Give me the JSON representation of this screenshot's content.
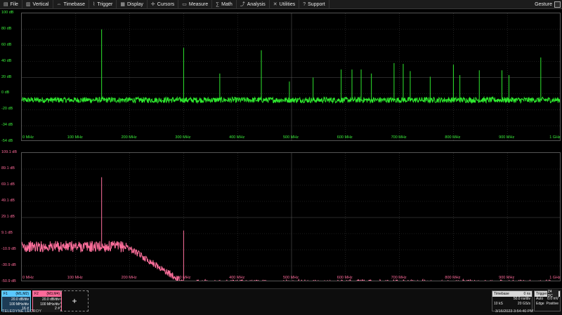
{
  "menu": [
    {
      "label": "File",
      "icon": "file-icon"
    },
    {
      "label": "Vertical",
      "icon": "vertical-icon"
    },
    {
      "label": "Timebase",
      "icon": "timebase-icon"
    },
    {
      "label": "Trigger",
      "icon": "trigger-icon"
    },
    {
      "label": "Display",
      "icon": "display-icon"
    },
    {
      "label": "Cursors",
      "icon": "cursors-icon"
    },
    {
      "label": "Measure",
      "icon": "measure-icon"
    },
    {
      "label": "Math",
      "icon": "math-icon"
    },
    {
      "label": "Analysis",
      "icon": "analysis-icon"
    },
    {
      "label": "Utilities",
      "icon": "utilities-icon"
    },
    {
      "label": "Support",
      "icon": "support-icon"
    }
  ],
  "gesture_label": "Gesture",
  "colors": {
    "trace1": "#2ee82e",
    "trace2": "#ff6f9c",
    "grid": "#3a3a3a"
  },
  "chart_data": [
    {
      "type": "line",
      "title": "",
      "xlabel": "",
      "ylabel": "",
      "x_ticks": [
        "0 MHz",
        "100 MHz",
        "200 MHz",
        "300 MHz",
        "400 MHz",
        "500 MHz",
        "600 MHz",
        "700 MHz",
        "800 MHz",
        "900 MHz",
        "1 GHz"
      ],
      "y_ticks": [
        "100 dB",
        "80 dB",
        "60 dB",
        "40 dB",
        "20 dB",
        "0 dB",
        "-20 dB",
        "-34 dB",
        "-54 dB"
      ],
      "xlim": [
        0,
        1000
      ],
      "ylim": [
        -60,
        100
      ],
      "noise_floor_db": -8,
      "peaks": [
        {
          "x": 148,
          "y": 80
        },
        {
          "x": 300,
          "y": 57
        },
        {
          "x": 367,
          "y": 25
        },
        {
          "x": 444,
          "y": 54
        },
        {
          "x": 496,
          "y": 15
        },
        {
          "x": 540,
          "y": 20
        },
        {
          "x": 592,
          "y": 30
        },
        {
          "x": 612,
          "y": 30
        },
        {
          "x": 629,
          "y": 30
        },
        {
          "x": 648,
          "y": 25
        },
        {
          "x": 690,
          "y": 38
        },
        {
          "x": 707,
          "y": 37
        },
        {
          "x": 720,
          "y": 28
        },
        {
          "x": 757,
          "y": 21
        },
        {
          "x": 800,
          "y": 36
        },
        {
          "x": 812,
          "y": 23
        },
        {
          "x": 848,
          "y": 29
        },
        {
          "x": 890,
          "y": 29
        },
        {
          "x": 903,
          "y": 23
        },
        {
          "x": 962,
          "y": 45
        }
      ]
    },
    {
      "type": "line",
      "title": "",
      "xlabel": "",
      "ylabel": "",
      "x_ticks": [
        "0 MHz",
        "100 MHz",
        "200 MHz",
        "300 MHz",
        "400 MHz",
        "500 MHz",
        "600 MHz",
        "700 MHz",
        "800 MHz",
        "900 MHz",
        "1 GHz"
      ],
      "y_ticks": [
        "109.1 dB",
        "89.1 dB",
        "69.1 dB",
        "49.1 dB",
        "29.1 dB",
        "9.1 dB",
        "-10.9 dB",
        "-30.9 dB",
        "-50.9 dB"
      ],
      "xlim": [
        0,
        1000
      ],
      "ylim": [
        -50.9,
        109.1
      ],
      "passband_level_db": -7,
      "rolloff_start_mhz": 195,
      "rolloff_end_mhz": 300,
      "stopband_level_db": -52,
      "peaks": [
        {
          "x": 148,
          "y": 79
        },
        {
          "x": 300,
          "y": 13
        }
      ]
    }
  ],
  "traces": [
    {
      "name": "F1",
      "source": "(M1,M2)",
      "vdiv": "20.0 dB/div",
      "hdiv": "100 MHz/div",
      "extra": "16 #"
    },
    {
      "name": "F2",
      "source": "(M3,M4)",
      "vdiv": "20.0 dB/div",
      "hdiv": "100 MHz/div",
      "extra": "2 #"
    }
  ],
  "add_symbol": "+",
  "timebase": {
    "label": "Timebase",
    "offset": "0 ns",
    "rate": "50.0 ns/div",
    "samples": "10 kS",
    "srate": "20 GS/s"
  },
  "trigger": {
    "label": "Trigger",
    "badge": "Z4 DC",
    "mode": "Auto",
    "level": "0.0 mV",
    "type": "Edge",
    "slope": "Positive"
  },
  "brand": "TELEDYNE LECROY",
  "datetime": "3/16/2023 3:54:40 PM"
}
